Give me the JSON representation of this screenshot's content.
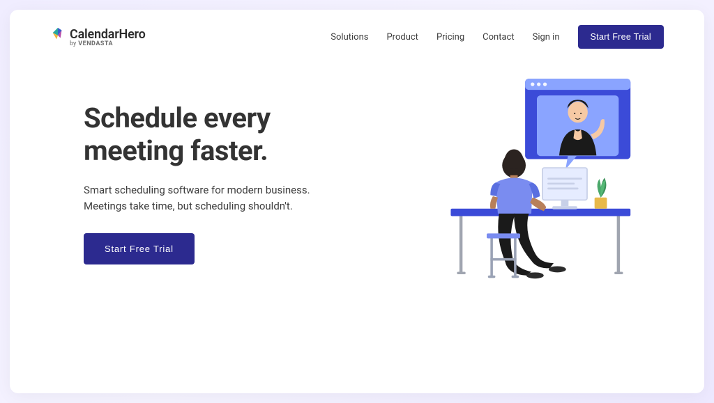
{
  "brand": {
    "name": "CalendarHero",
    "byline_prefix": "by",
    "byline_company": "VENDASTA"
  },
  "nav": {
    "links": [
      {
        "label": "Solutions"
      },
      {
        "label": "Product"
      },
      {
        "label": "Pricing"
      },
      {
        "label": "Contact"
      },
      {
        "label": "Sign in"
      }
    ],
    "cta_label": "Start Free Trial"
  },
  "hero": {
    "title_line1": "Schedule every",
    "title_line2": "meeting faster.",
    "description": "Smart scheduling software for modern business. Meetings take time, but scheduling shouldn't.",
    "cta_label": "Start Free Trial"
  },
  "colors": {
    "primary": "#2c2a8f",
    "text_dark": "#333333"
  }
}
